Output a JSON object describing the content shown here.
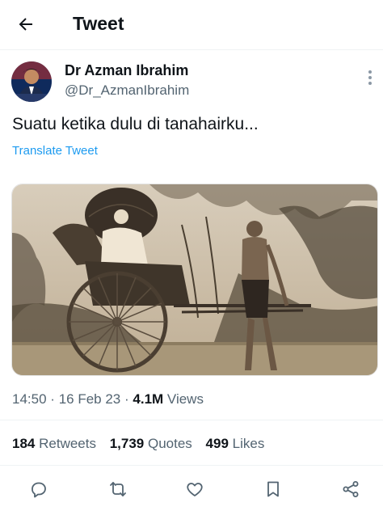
{
  "header": {
    "title": "Tweet",
    "back_icon": "arrow-left-icon"
  },
  "author": {
    "display_name": "Dr Azman Ibrahim",
    "handle": "@Dr_AzmanIbrahim"
  },
  "tweet": {
    "text": "Suatu ketika dulu di tanahairku...",
    "translate_label": "Translate Tweet",
    "media_description_icon": "photo-rickshaw"
  },
  "meta": {
    "time": "14:50",
    "date": "16 Feb 23",
    "views_count": "4.1M",
    "views_label": "Views",
    "separator": "·"
  },
  "stats": {
    "retweets_count": "184",
    "retweets_label": "Retweets",
    "quotes_count": "1,739",
    "quotes_label": "Quotes",
    "likes_count": "499",
    "likes_label": "Likes"
  },
  "actions": [
    "reply-icon",
    "retweet-icon",
    "like-icon",
    "bookmark-icon",
    "share-icon"
  ],
  "colors": {
    "link": "#1d9bf0",
    "secondary_text": "#536471",
    "primary_text": "#0f1419",
    "divider": "#eff3f4"
  }
}
